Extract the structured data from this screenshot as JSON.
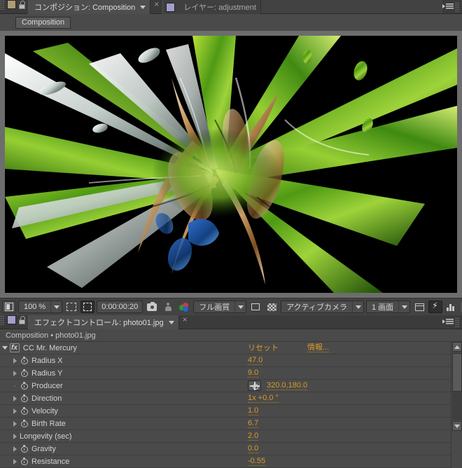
{
  "app": "Adobe After Effects",
  "top_tabs": {
    "tabs": [
      {
        "label": "コンポジション: Composition",
        "selected": true,
        "swatch": "#b09b77",
        "close": "×"
      },
      {
        "label": "レイヤー: adjustment",
        "selected": false,
        "swatch": "#a0a0cc",
        "close": ""
      }
    ],
    "lock_icon": "lock-icon",
    "menu_icon": "panel-menu-icon"
  },
  "composition": {
    "breadcrumb_button": "Composition",
    "canvas_alt": "CC Mr. Mercury abstract liquid metal render"
  },
  "comp_toolbar": {
    "always_preview_icon": "always-preview-icon",
    "zoom_value": "100 %",
    "zoom_arrow": "chevron-down-icon",
    "roi_icon": "region-of-interest-icon",
    "grid_guides_icon": "grid-and-guides-icon",
    "timecode": "0:00:00:20",
    "snapshot_icon": "camera-snapshot-icon",
    "show_snapshot_icon": "show-snapshot-icon",
    "channels_icon": "rgb-channels-icon",
    "resolution": "フル画質",
    "resolution_arrow": "chevron-down-icon",
    "toggle_mask_icon": "toggle-mask-icon",
    "transparency_grid_icon": "transparency-grid-icon",
    "camera_view": "アクティブカメラ",
    "camera_arrow": "chevron-down-icon",
    "view_layout": "1 画面",
    "view_layout_arrow": "chevron-down-icon",
    "timeline_icon": "timeline-icon",
    "fast_preview_icon": "fast-preview-icon",
    "render_graph_icon": "render-graph-icon"
  },
  "effect_controls": {
    "tab_label": "エフェクトコントロール: photo01.jpg",
    "tab_close": "×",
    "tab_arrow": "chevron-down-icon",
    "subheader": "Composition • photo01.jpg",
    "effect_name": "CC Mr. Mercury",
    "fx_badge": "fx",
    "reset_label": "リセット",
    "about_label": "情報...",
    "properties": [
      {
        "name": "Radius X",
        "value": "47.0",
        "twirl": "right",
        "stopwatch": true,
        "indent": 1,
        "type": "number"
      },
      {
        "name": "Radius Y",
        "value": "9.0",
        "twirl": "right",
        "stopwatch": true,
        "indent": 1,
        "type": "number"
      },
      {
        "name": "Producer",
        "value": "320.0,180.0",
        "twirl": "dot",
        "stopwatch": true,
        "indent": 1,
        "type": "point"
      },
      {
        "name": "Direction",
        "value": "1x +0.0 °",
        "twirl": "right",
        "stopwatch": true,
        "indent": 1,
        "type": "angle"
      },
      {
        "name": "Velocity",
        "value": "1.0",
        "twirl": "right",
        "stopwatch": true,
        "indent": 1,
        "type": "number"
      },
      {
        "name": "Birth Rate",
        "value": "6.7",
        "twirl": "right",
        "stopwatch": true,
        "indent": 1,
        "type": "number"
      },
      {
        "name": "Longevity (sec)",
        "value": "2.0",
        "twirl": "right",
        "stopwatch": false,
        "indent": 1,
        "type": "number"
      },
      {
        "name": "Gravity",
        "value": "0.0",
        "twirl": "right",
        "stopwatch": true,
        "indent": 1,
        "type": "number"
      },
      {
        "name": "Resistance",
        "value": "-0.55",
        "twirl": "right",
        "stopwatch": true,
        "indent": 1,
        "type": "number"
      }
    ],
    "scrollbar": {
      "up_arrow": "scroll-up-icon",
      "down_arrow": "scroll-down-icon"
    }
  },
  "colors": {
    "panel_bg": "#4a4a4a",
    "tab_bg": "#3b3b3b",
    "value_orange": "#d89a2a",
    "text": "#d2d2d2"
  }
}
